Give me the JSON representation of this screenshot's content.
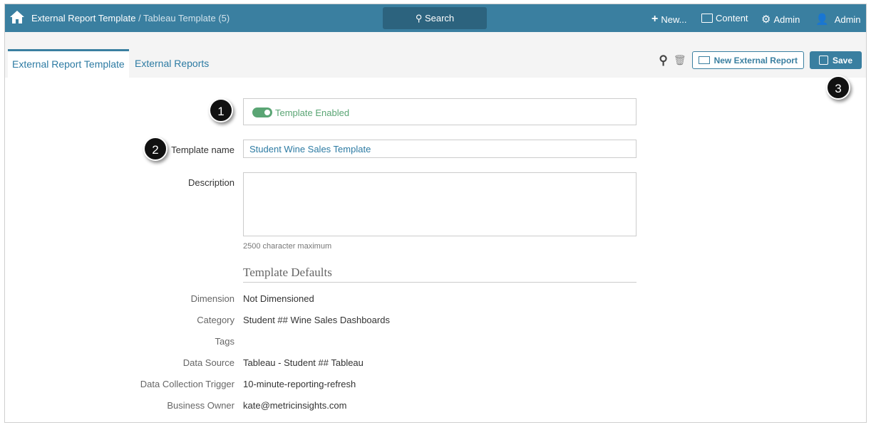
{
  "header": {
    "breadcrumb_main": "External Report Template",
    "breadcrumb_sub": " / Tableau Template (5)",
    "search": "Search",
    "new": "New...",
    "content": "Content",
    "admin_settings": "Admin",
    "user": "Admin"
  },
  "tabs": [
    {
      "label": "External Report Template"
    },
    {
      "label": "External Reports"
    }
  ],
  "toolbar": {
    "new_report": "New External Report",
    "save": "Save"
  },
  "badges": [
    "1",
    "2",
    "3"
  ],
  "form": {
    "enabled_label": "Template Enabled",
    "name_label": "Template name",
    "name_value": "Student Wine Sales Template",
    "description_label": "Description",
    "description_value": "",
    "description_hint": "2500 character maximum",
    "section_title": "Template Defaults",
    "fields": [
      {
        "label": "Dimension",
        "value": "Not Dimensioned"
      },
      {
        "label": "Category",
        "value": "Student ## Wine Sales Dashboards"
      },
      {
        "label": "Tags",
        "value": ""
      },
      {
        "label": "Data Source",
        "value": "Tableau - Student ## Tableau"
      },
      {
        "label": "Data Collection Trigger",
        "value": "10-minute-reporting-refresh"
      },
      {
        "label": "Business Owner",
        "value": "kate@metricinsights.com"
      }
    ]
  },
  "colors": {
    "brand": "#3a7fa0",
    "toggle": "#5aa574"
  }
}
